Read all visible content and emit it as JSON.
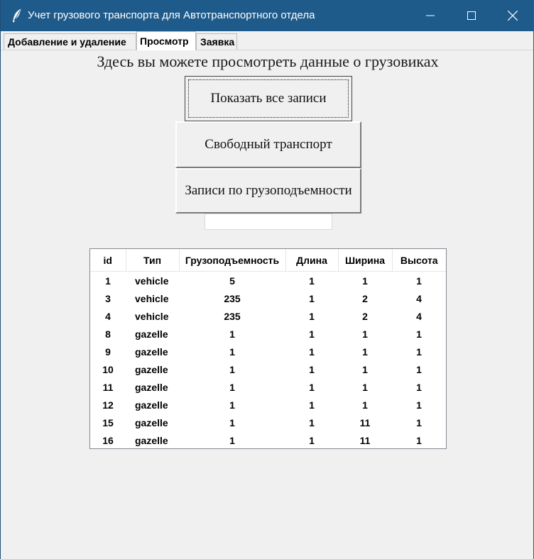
{
  "window": {
    "title": "Учет грузового транспорта для Автотранспортного отдела"
  },
  "tabs": [
    {
      "label": "Добавление и удаление"
    },
    {
      "label": "Просмотр"
    },
    {
      "label": "Заявка"
    }
  ],
  "view": {
    "heading": "Здесь вы можете просмотреть данные о грузовиках",
    "buttons": {
      "show_all": "Показать все записи",
      "free_transport": "Свободный транспорт",
      "by_capacity": "Записи по грузоподъемности"
    },
    "capacity_input": {
      "value": ""
    }
  },
  "table": {
    "columns": [
      "id",
      "Тип",
      "Грузоподъемность",
      "Длина",
      "Ширина",
      "Высота"
    ],
    "rows": [
      [
        "1",
        "vehicle",
        "5",
        "1",
        "1",
        "1"
      ],
      [
        "3",
        "vehicle",
        "235",
        "1",
        "2",
        "4"
      ],
      [
        "4",
        "vehicle",
        "235",
        "1",
        "2",
        "4"
      ],
      [
        "8",
        "gazelle",
        "1",
        "1",
        "1",
        "1"
      ],
      [
        "9",
        "gazelle",
        "1",
        "1",
        "1",
        "1"
      ],
      [
        "10",
        "gazelle",
        "1",
        "1",
        "1",
        "1"
      ],
      [
        "11",
        "gazelle",
        "1",
        "1",
        "1",
        "1"
      ],
      [
        "12",
        "gazelle",
        "1",
        "1",
        "1",
        "1"
      ],
      [
        "15",
        "gazelle",
        "1",
        "1",
        "11",
        "1"
      ],
      [
        "16",
        "gazelle",
        "1",
        "1",
        "11",
        "1"
      ]
    ]
  },
  "icons": {
    "app": "feather-icon",
    "minimize": "minimize-icon",
    "maximize": "maximize-icon",
    "close": "close-icon"
  },
  "colors": {
    "titlebar": "#1f5b8a",
    "window_bg": "#f0f0f0"
  }
}
